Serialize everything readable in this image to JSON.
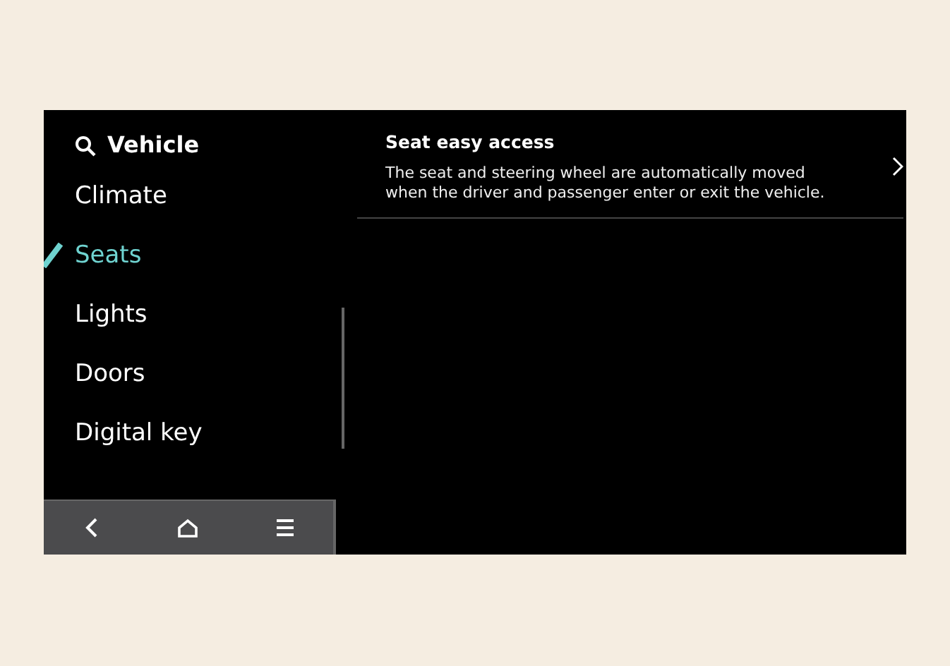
{
  "header": {
    "title": "Vehicle"
  },
  "menu": [
    {
      "label": "Climate",
      "selected": false
    },
    {
      "label": "Seats",
      "selected": true
    },
    {
      "label": "Lights",
      "selected": false
    },
    {
      "label": "Doors",
      "selected": false
    },
    {
      "label": "Digital key",
      "selected": false
    }
  ],
  "settings": [
    {
      "title": "Seat easy access",
      "description": "The seat and steering wheel are automatically moved when the driver and passenger enter or exit the vehicle."
    }
  ]
}
